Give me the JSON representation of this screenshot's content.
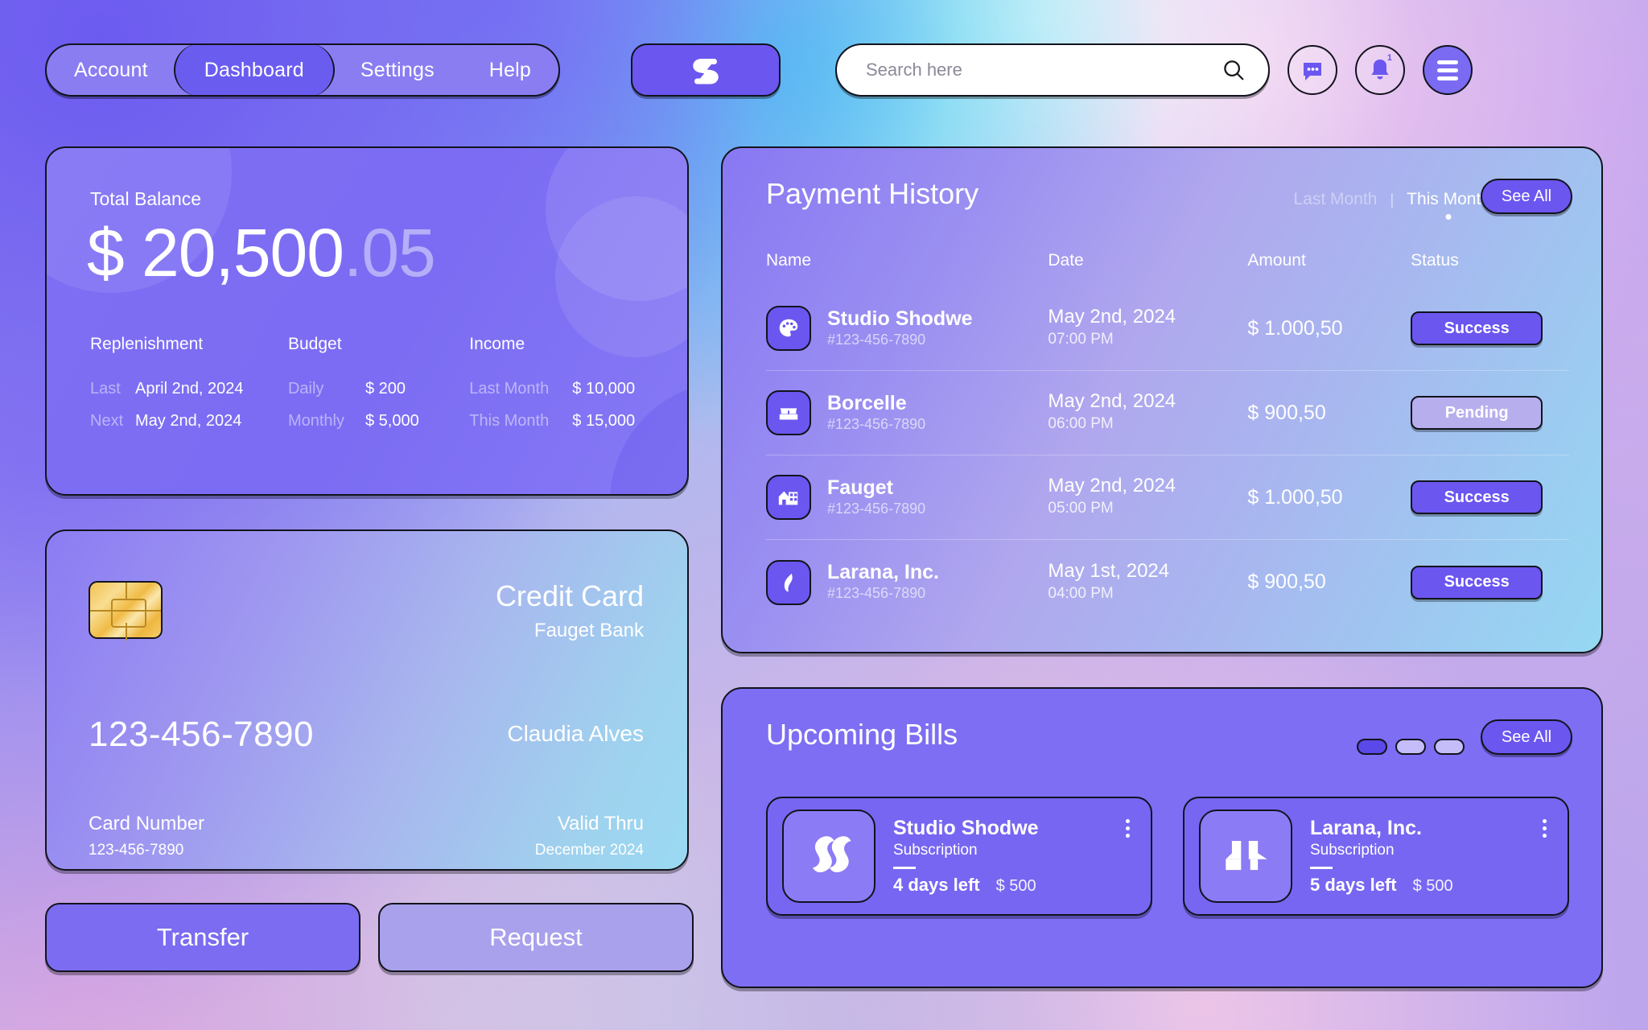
{
  "nav": {
    "items": [
      {
        "label": "Account",
        "active": false
      },
      {
        "label": "Dashboard",
        "active": true
      },
      {
        "label": "Settings",
        "active": false
      },
      {
        "label": "Help",
        "active": false
      }
    ]
  },
  "brand": {
    "logo_icon": "s-monogram-logo"
  },
  "search": {
    "placeholder": "Search here",
    "value": "",
    "icon": "search-icon"
  },
  "header_actions": {
    "messages": {
      "icon": "chat-bubble-icon"
    },
    "notifications": {
      "icon": "bell-icon",
      "badge": "1"
    },
    "menu": {
      "icon": "hamburger-menu-icon"
    }
  },
  "balance": {
    "label": "Total Balance",
    "amount_main": "$ 20,500",
    "amount_cents": ".05",
    "columns": [
      {
        "title": "Replenishment",
        "rows": [
          {
            "key": "Last",
            "value": "April 2nd, 2024"
          },
          {
            "key": "Next",
            "value": "May 2nd, 2024"
          }
        ]
      },
      {
        "title": "Budget",
        "rows": [
          {
            "key": "Daily",
            "value": "$ 200"
          },
          {
            "key": "Monthly",
            "value": "$ 5,000"
          }
        ]
      },
      {
        "title": "Income",
        "rows": [
          {
            "key": "Last Month",
            "value": "$ 10,000"
          },
          {
            "key": "This Month",
            "value": "$ 15,000"
          }
        ]
      }
    ]
  },
  "credit_card": {
    "type": "Credit Card",
    "bank": "Fauget Bank",
    "number_display": "123-456-7890",
    "holder": "Claudia Alves",
    "card_number_label": "Card Number",
    "card_number_value": "123-456-7890",
    "valid_thru_label": "Valid Thru",
    "valid_thru_value": "December 2024",
    "chip_icon": "emv-chip-icon"
  },
  "actions": {
    "transfer": "Transfer",
    "request": "Request"
  },
  "payment_history": {
    "title": "Payment History",
    "filters": [
      {
        "label": "Last Month",
        "active": false
      },
      {
        "label": "This Month",
        "active": true
      }
    ],
    "separator": "|",
    "see_all": "See All",
    "columns": [
      "Name",
      "Date",
      "Amount",
      "Status"
    ],
    "rows": [
      {
        "icon": "palette-icon",
        "name": "Studio Shodwe",
        "ref": "#123-456-7890",
        "date": "May 2nd, 2024",
        "time": "07:00 PM",
        "amount": "$ 1.000,50",
        "status": "Success",
        "status_kind": "success"
      },
      {
        "icon": "bed-icon",
        "name": "Borcelle",
        "ref": "#123-456-7890",
        "date": "May 2nd, 2024",
        "time": "06:00 PM",
        "amount": "$ 900,50",
        "status": "Pending",
        "status_kind": "pending"
      },
      {
        "icon": "house-building-icon",
        "name": "Fauget",
        "ref": "#123-456-7890",
        "date": "May 2nd, 2024",
        "time": "05:00 PM",
        "amount": "$ 1.000,50",
        "status": "Success",
        "status_kind": "success"
      },
      {
        "icon": "leaf-face-icon",
        "name": "Larana, Inc.",
        "ref": "#123-456-7890",
        "date": "May 1st, 2024",
        "time": "04:00 PM",
        "amount": "$ 900,50",
        "status": "Success",
        "status_kind": "success"
      }
    ]
  },
  "upcoming_bills": {
    "title": "Upcoming Bills",
    "see_all": "See All",
    "pagination": [
      true,
      false,
      false
    ],
    "cards": [
      {
        "logo_icon": "double-s-logo-icon",
        "name": "Studio Shodwe",
        "type": "Subscription",
        "days_left": "4 days left",
        "amount": "$ 500",
        "menu_icon": "kebab-menu-icon"
      },
      {
        "logo_icon": "larana-blocks-logo-icon",
        "name": "Larana, Inc.",
        "type": "Subscription",
        "days_left": "5 days left",
        "amount": "$ 500",
        "menu_icon": "kebab-menu-icon"
      }
    ]
  },
  "colors": {
    "accent": "#6b56f0",
    "accent_light": "#7e6ef3",
    "pending": "#b7aeee",
    "outline": "#12131c",
    "text_on_card": "#ffffff"
  }
}
